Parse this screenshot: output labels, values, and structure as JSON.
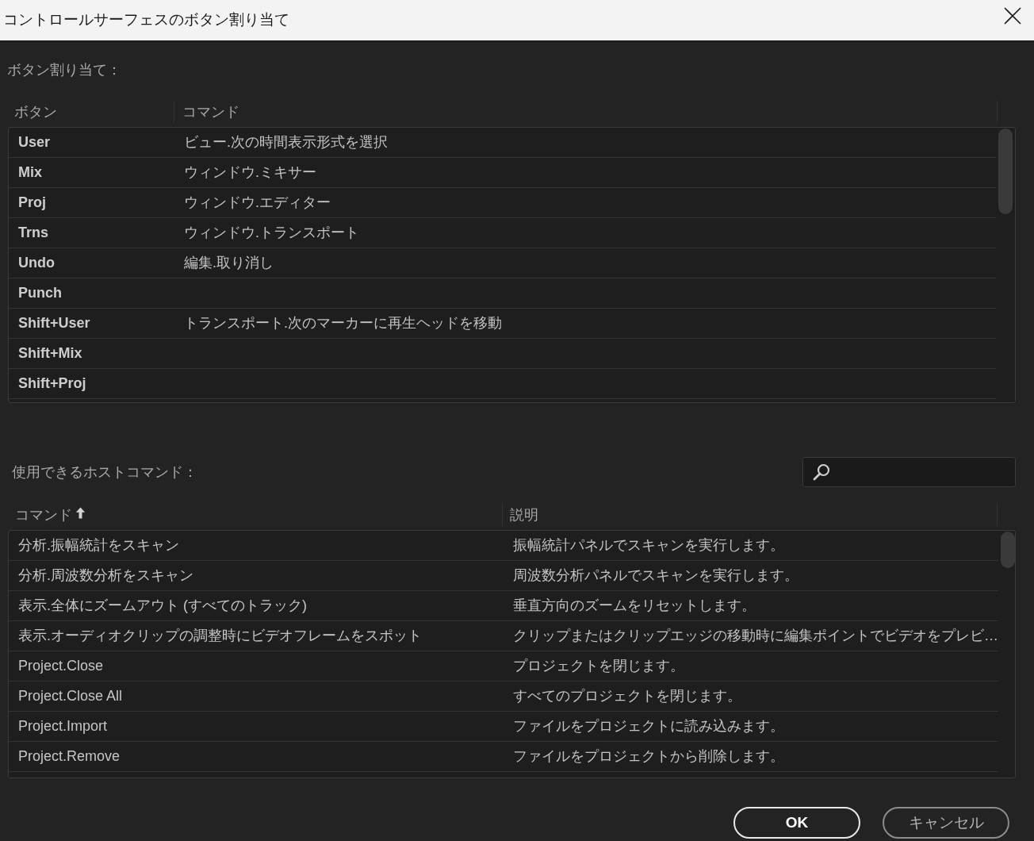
{
  "window": {
    "title": "コントロールサーフェスのボタン割り当て"
  },
  "button_assignments": {
    "label": "ボタン割り当て：",
    "columns": [
      {
        "label": "ボタン"
      },
      {
        "label": "コマンド"
      }
    ],
    "rows": [
      {
        "button": "User",
        "command": "ビュー.次の時間表示形式を選択"
      },
      {
        "button": "Mix",
        "command": "ウィンドウ.ミキサー"
      },
      {
        "button": "Proj",
        "command": "ウィンドウ.エディター"
      },
      {
        "button": "Trns",
        "command": "ウィンドウ.トランスポート"
      },
      {
        "button": "Undo",
        "command": "編集.取り消し"
      },
      {
        "button": "Punch"
      },
      {
        "button": "Shift+User",
        "command": "トランスポート.次のマーカーに再生ヘッドを移動"
      },
      {
        "button": "Shift+Mix"
      },
      {
        "button": "Shift+Proj"
      }
    ]
  },
  "host_commands": {
    "label": "使用できるホストコマンド：",
    "columns": [
      {
        "label": "コマンド",
        "sorted": true
      },
      {
        "label": "説明",
        "sorted": false
      }
    ],
    "rows": [
      {
        "command": "分析.振幅統計をスキャン",
        "description": "振幅統計パネルでスキャンを実行します。"
      },
      {
        "command": "分析.周波数分析をスキャン",
        "description": "周波数分析パネルでスキャンを実行します。"
      },
      {
        "command": "表示.全体にズームアウト (すべてのトラック)",
        "description": "垂直方向のズームをリセットします。"
      },
      {
        "command": "表示.オーディオクリップの調整時にビデオフレームをスポット",
        "description": "クリップまたはクリップエッジの移動時に編集ポイントでビデオをプレビ…"
      },
      {
        "command": "Project.Close",
        "description": "プロジェクトを閉じます。"
      },
      {
        "command": "Project.Close All",
        "description": "すべてのプロジェクトを閉じます。"
      },
      {
        "command": "Project.Import",
        "description": "ファイルをプロジェクトに読み込みます。"
      },
      {
        "command": "Project.Remove",
        "description": "ファイルをプロジェクトから削除します。"
      }
    ]
  },
  "buttons": [
    {
      "label": "OK",
      "default": true
    },
    {
      "label": "キャンセル",
      "default": false
    }
  ]
}
